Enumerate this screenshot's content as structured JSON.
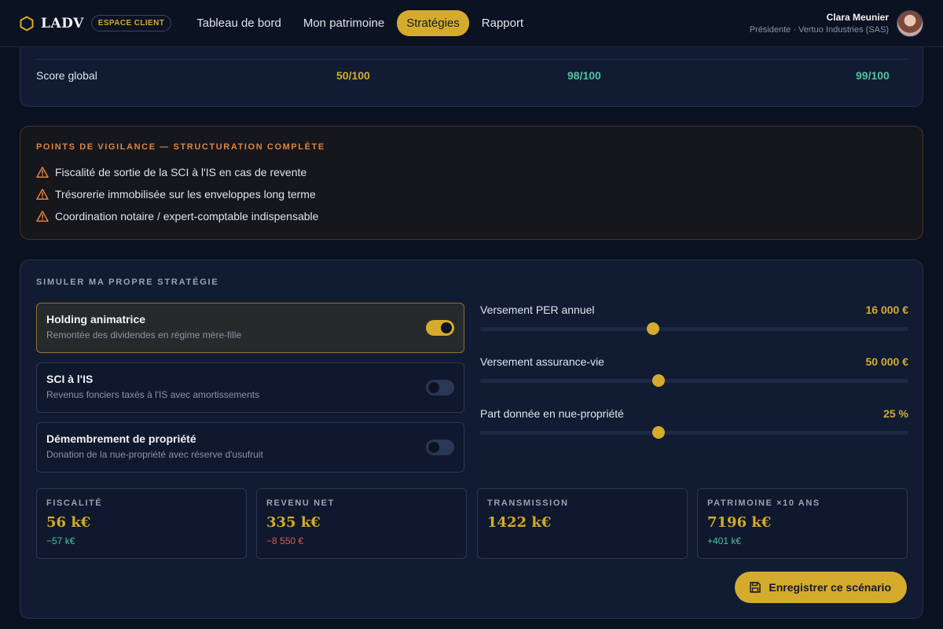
{
  "brand": {
    "name": "LADV",
    "badge": "ESPACE CLIENT"
  },
  "nav": [
    {
      "label": "Tableau de bord",
      "active": false
    },
    {
      "label": "Mon patrimoine",
      "active": false
    },
    {
      "label": "Stratégies",
      "active": true
    },
    {
      "label": "Rapport",
      "active": false
    }
  ],
  "user": {
    "name": "Clara Meunier",
    "role": "Présidente · Vertuo Industries (SAS)"
  },
  "score": {
    "label": "Score global",
    "values": [
      {
        "text": "50/100",
        "color": "#d4ab2c"
      },
      {
        "text": "98/100",
        "color": "#4fc3a1"
      },
      {
        "text": "99/100",
        "color": "#4fc3a1"
      }
    ]
  },
  "vigilance": {
    "title": "POINTS DE VIGILANCE — STRUCTURATION COMPLÈTE",
    "items": [
      "Fiscalité de sortie de la SCI à l'IS en cas de revente",
      "Trésorerie immobilisée sur les enveloppes long terme",
      "Coordination notaire / expert-comptable indispensable"
    ]
  },
  "simulator": {
    "title": "SIMULER MA PROPRE STRATÉGIE",
    "options": [
      {
        "title": "Holding animatrice",
        "desc": "Remontée des dividendes en régime mère-fille",
        "enabled": true
      },
      {
        "title": "SCI à l'IS",
        "desc": "Revenus fonciers taxés à l'IS avec amortissements",
        "enabled": false
      },
      {
        "title": "Démembrement de propriété",
        "desc": "Donation de la nue-propriété avec réserve d'usufruit",
        "enabled": false
      }
    ],
    "sliders": [
      {
        "label": "Versement PER annuel",
        "value": "16 000 €",
        "fraction": 0.404
      },
      {
        "label": "Versement assurance-vie",
        "value": "50 000 €",
        "fraction": 0.417
      },
      {
        "label": "Part donnée en nue-propriété",
        "value": "25 %",
        "fraction": 0.417
      }
    ],
    "metrics": [
      {
        "label": "FISCALITÉ",
        "value": "56 k€",
        "delta": "−57 k€",
        "delta_color": "#4fc3a1"
      },
      {
        "label": "REVENU NET",
        "value": "335 k€",
        "delta": "−8 550 €",
        "delta_color": "#e0584f"
      },
      {
        "label": "TRANSMISSION",
        "value": "1422 k€",
        "delta": "",
        "delta_color": "#4fc3a1"
      },
      {
        "label": "PATRIMOINE ×10 ANS",
        "value": "7196 k€",
        "delta": "+401 k€",
        "delta_color": "#4fc3a1"
      }
    ],
    "save_label": "Enregistrer ce scénario"
  },
  "icons": {
    "logo": "hexagon-logo-icon",
    "warning": "warning-triangle-icon",
    "save": "floppy-disk-icon"
  }
}
